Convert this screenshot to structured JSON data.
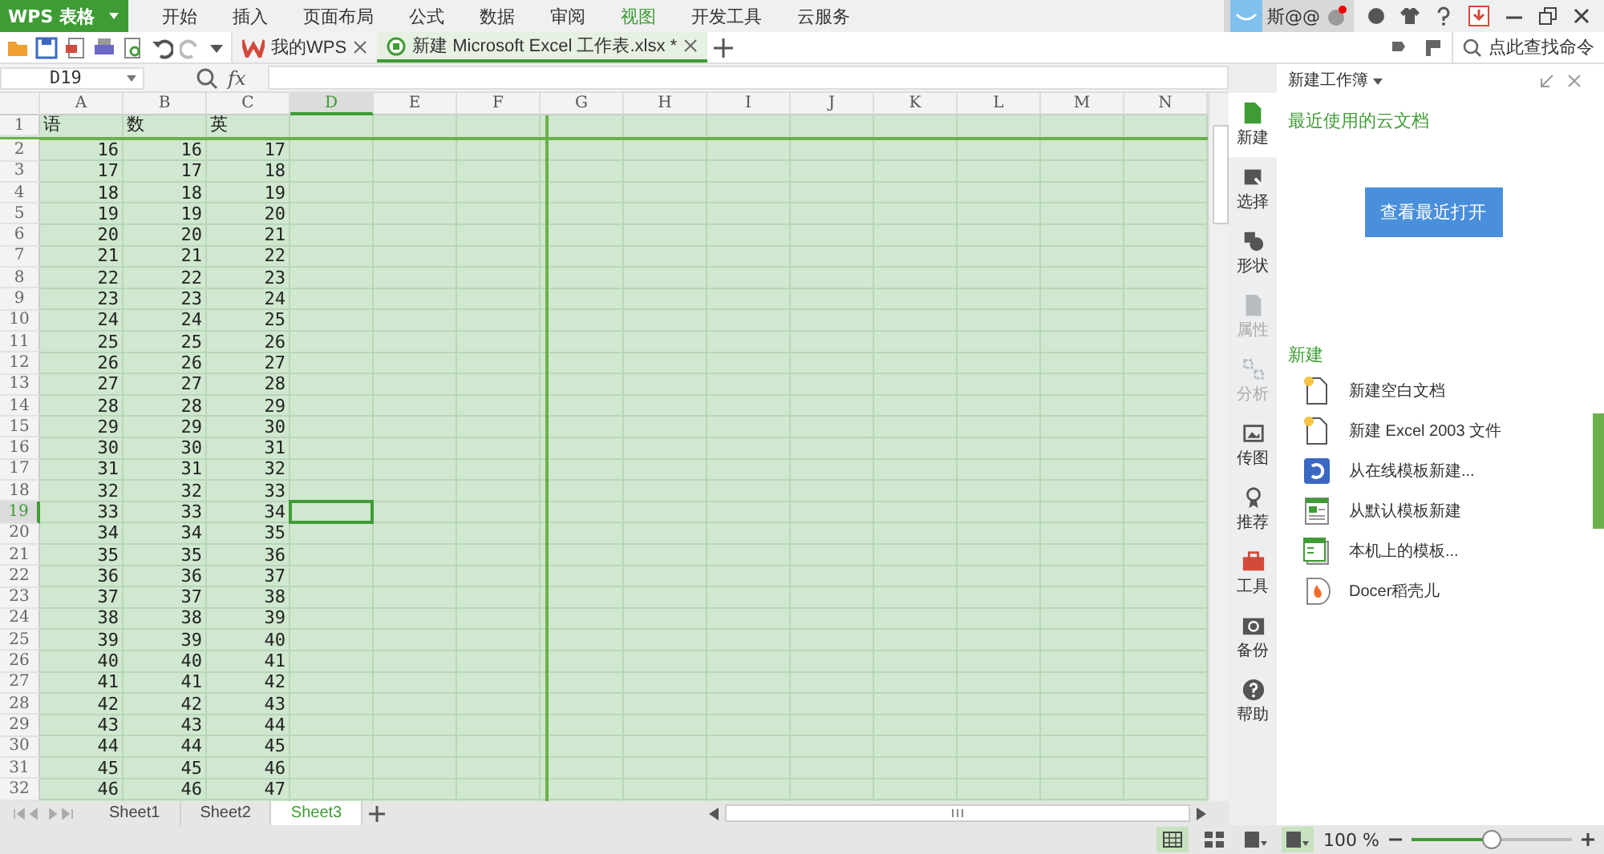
{
  "menu_bar": {
    "app_button": "WPS 表格",
    "tabs": [
      {
        "label": "开始",
        "selected": false
      },
      {
        "label": "插入",
        "selected": false
      },
      {
        "label": "页面布局",
        "selected": false
      },
      {
        "label": "公式",
        "selected": false
      },
      {
        "label": "数据",
        "selected": false
      },
      {
        "label": "审阅",
        "selected": false
      },
      {
        "label": "视图",
        "selected": true
      },
      {
        "label": "开发工具",
        "selected": false
      },
      {
        "label": "云服务",
        "selected": false
      }
    ],
    "user_name": "斯@@"
  },
  "quick_toolbar": {
    "doc_tabs": [
      {
        "label": "我的WPS",
        "selected": false
      },
      {
        "label": "新建 Microsoft Excel 工作表.xlsx *",
        "selected": true
      }
    ],
    "command_search": "点此查找命令"
  },
  "formula_bar": {
    "cell_name": "D19",
    "fx": "fx"
  },
  "sheet": {
    "columns": [
      {
        "label": "A",
        "selected": false
      },
      {
        "label": "B",
        "selected": false
      },
      {
        "label": "C",
        "selected": false
      },
      {
        "label": "D",
        "selected": true
      },
      {
        "label": "E",
        "selected": false
      },
      {
        "label": "F",
        "selected": false
      },
      {
        "label": "G",
        "selected": false
      },
      {
        "label": "H",
        "selected": false
      },
      {
        "label": "I",
        "selected": false
      },
      {
        "label": "J",
        "selected": false
      },
      {
        "label": "K",
        "selected": false
      },
      {
        "label": "L",
        "selected": false
      },
      {
        "label": "M",
        "selected": false
      },
      {
        "label": "N",
        "selected": false
      }
    ],
    "rows": [
      {
        "number": "1",
        "selected": false,
        "kind": "text",
        "cells": [
          "语",
          "数",
          "英"
        ]
      },
      {
        "number": "2",
        "selected": false,
        "kind": "number",
        "cells": [
          "16",
          "16",
          "17"
        ]
      },
      {
        "number": "3",
        "selected": false,
        "kind": "number",
        "cells": [
          "17",
          "17",
          "18"
        ]
      },
      {
        "number": "4",
        "selected": false,
        "kind": "number",
        "cells": [
          "18",
          "18",
          "19"
        ]
      },
      {
        "number": "5",
        "selected": false,
        "kind": "number",
        "cells": [
          "19",
          "19",
          "20"
        ]
      },
      {
        "number": "6",
        "selected": false,
        "kind": "number",
        "cells": [
          "20",
          "20",
          "21"
        ]
      },
      {
        "number": "7",
        "selected": false,
        "kind": "number",
        "cells": [
          "21",
          "21",
          "22"
        ]
      },
      {
        "number": "8",
        "selected": false,
        "kind": "number",
        "cells": [
          "22",
          "22",
          "23"
        ]
      },
      {
        "number": "9",
        "selected": false,
        "kind": "number",
        "cells": [
          "23",
          "23",
          "24"
        ]
      },
      {
        "number": "10",
        "selected": false,
        "kind": "number",
        "cells": [
          "24",
          "24",
          "25"
        ]
      },
      {
        "number": "11",
        "selected": false,
        "kind": "number",
        "cells": [
          "25",
          "25",
          "26"
        ]
      },
      {
        "number": "12",
        "selected": false,
        "kind": "number",
        "cells": [
          "26",
          "26",
          "27"
        ]
      },
      {
        "number": "13",
        "selected": false,
        "kind": "number",
        "cells": [
          "27",
          "27",
          "28"
        ]
      },
      {
        "number": "14",
        "selected": false,
        "kind": "number",
        "cells": [
          "28",
          "28",
          "29"
        ]
      },
      {
        "number": "15",
        "selected": false,
        "kind": "number",
        "cells": [
          "29",
          "29",
          "30"
        ]
      },
      {
        "number": "16",
        "selected": false,
        "kind": "number",
        "cells": [
          "30",
          "30",
          "31"
        ]
      },
      {
        "number": "17",
        "selected": false,
        "kind": "number",
        "cells": [
          "31",
          "31",
          "32"
        ]
      },
      {
        "number": "18",
        "selected": false,
        "kind": "number",
        "cells": [
          "32",
          "32",
          "33"
        ]
      },
      {
        "number": "19",
        "selected": true,
        "kind": "number",
        "cells": [
          "33",
          "33",
          "34"
        ]
      },
      {
        "number": "20",
        "selected": false,
        "kind": "number",
        "cells": [
          "34",
          "34",
          "35"
        ]
      },
      {
        "number": "21",
        "selected": false,
        "kind": "number",
        "cells": [
          "35",
          "35",
          "36"
        ]
      },
      {
        "number": "22",
        "selected": false,
        "kind": "number",
        "cells": [
          "36",
          "36",
          "37"
        ]
      },
      {
        "number": "23",
        "selected": false,
        "kind": "number",
        "cells": [
          "37",
          "37",
          "38"
        ]
      },
      {
        "number": "24",
        "selected": false,
        "kind": "number",
        "cells": [
          "38",
          "38",
          "39"
        ]
      },
      {
        "number": "25",
        "selected": false,
        "kind": "number",
        "cells": [
          "39",
          "39",
          "40"
        ]
      },
      {
        "number": "26",
        "selected": false,
        "kind": "number",
        "cells": [
          "40",
          "40",
          "41"
        ]
      },
      {
        "number": "27",
        "selected": false,
        "kind": "number",
        "cells": [
          "41",
          "41",
          "42"
        ]
      },
      {
        "number": "28",
        "selected": false,
        "kind": "number",
        "cells": [
          "42",
          "42",
          "43"
        ]
      },
      {
        "number": "29",
        "selected": false,
        "kind": "number",
        "cells": [
          "43",
          "43",
          "44"
        ]
      },
      {
        "number": "30",
        "selected": false,
        "kind": "number",
        "cells": [
          "44",
          "44",
          "45"
        ]
      },
      {
        "number": "31",
        "selected": false,
        "kind": "number",
        "cells": [
          "45",
          "45",
          "46"
        ]
      },
      {
        "number": "32",
        "selected": false,
        "kind": "number",
        "cells": [
          "46",
          "46",
          "47"
        ]
      }
    ]
  },
  "sheet_tabs": [
    {
      "label": "Sheet1",
      "selected": false
    },
    {
      "label": "Sheet2",
      "selected": false
    },
    {
      "label": "Sheet3",
      "selected": true
    }
  ],
  "status_bar": {
    "zoom": "100 %",
    "zoom_slider": {
      "level": 0.5
    }
  },
  "side_panel": {
    "nav": [
      {
        "label": "新建",
        "selected": true,
        "disabled": false,
        "kind": "new"
      },
      {
        "label": "选择",
        "selected": false,
        "disabled": false,
        "kind": "select"
      },
      {
        "label": "形状",
        "selected": false,
        "disabled": false,
        "kind": "shape"
      },
      {
        "label": "属性",
        "selected": false,
        "disabled": true,
        "kind": "props"
      },
      {
        "label": "分析",
        "selected": false,
        "disabled": true,
        "kind": "analyze"
      },
      {
        "label": "传图",
        "selected": false,
        "disabled": false,
        "kind": "image"
      },
      {
        "label": "推荐",
        "selected": false,
        "disabled": false,
        "kind": "award"
      },
      {
        "label": "工具",
        "selected": false,
        "disabled": false,
        "kind": "toolbox"
      },
      {
        "label": "备份",
        "selected": false,
        "disabled": false,
        "kind": "backup"
      },
      {
        "label": "帮助",
        "selected": false,
        "disabled": false,
        "kind": "help"
      }
    ],
    "title": "新建工作簿",
    "recent_heading": "最近使用的云文档",
    "recent_button": "查看最近打开",
    "new_heading": "新建",
    "new_items": [
      {
        "label": "新建空白文档",
        "kind": "blank"
      },
      {
        "label": "新建 Excel 2003 文件",
        "kind": "blank"
      },
      {
        "label": "从在线模板新建...",
        "kind": "online"
      },
      {
        "label": "从默认模板新建",
        "kind": "default"
      },
      {
        "label": "本机上的模板...",
        "kind": "local"
      },
      {
        "label": "Docer稻壳儿",
        "kind": "docer"
      }
    ]
  }
}
